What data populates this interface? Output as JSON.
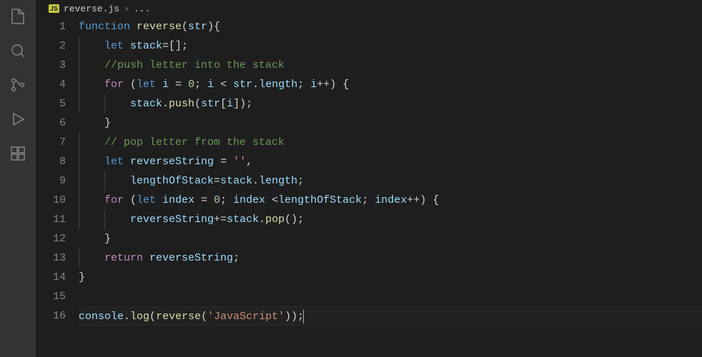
{
  "activity": {
    "icons": [
      "explorer",
      "search",
      "scm",
      "debug",
      "extensions"
    ]
  },
  "breadcrumbs": {
    "js_badge": "JS",
    "file": "reverse.js",
    "sep": "›",
    "tail": "..."
  },
  "gutter": {
    "start": 1,
    "end": 16
  },
  "code": {
    "lines": [
      [
        {
          "t": "function ",
          "c": "tok-kw"
        },
        {
          "t": "reverse",
          "c": "tok-fn"
        },
        {
          "t": "(",
          "c": "tok-op"
        },
        {
          "t": "str",
          "c": "tok-id"
        },
        {
          "t": "){",
          "c": "tok-op"
        }
      ],
      [
        {
          "t": "    ",
          "c": ""
        },
        {
          "t": "let ",
          "c": "tok-kw"
        },
        {
          "t": "stack",
          "c": "tok-id"
        },
        {
          "t": "=[];",
          "c": "tok-op"
        }
      ],
      [
        {
          "t": "    ",
          "c": ""
        },
        {
          "t": "//push letter into the stack",
          "c": "tok-cm"
        }
      ],
      [
        {
          "t": "    ",
          "c": ""
        },
        {
          "t": "for ",
          "c": "tok-ctrl"
        },
        {
          "t": "(",
          "c": "tok-op"
        },
        {
          "t": "let ",
          "c": "tok-kw"
        },
        {
          "t": "i",
          "c": "tok-id"
        },
        {
          "t": " = ",
          "c": "tok-op"
        },
        {
          "t": "0",
          "c": "tok-num"
        },
        {
          "t": "; ",
          "c": "tok-op"
        },
        {
          "t": "i",
          "c": "tok-id"
        },
        {
          "t": " < ",
          "c": "tok-op"
        },
        {
          "t": "str",
          "c": "tok-id"
        },
        {
          "t": ".",
          "c": "tok-op"
        },
        {
          "t": "length",
          "c": "tok-id"
        },
        {
          "t": "; ",
          "c": "tok-op"
        },
        {
          "t": "i",
          "c": "tok-id"
        },
        {
          "t": "++) {",
          "c": "tok-op"
        }
      ],
      [
        {
          "t": "        ",
          "c": ""
        },
        {
          "t": "stack",
          "c": "tok-id"
        },
        {
          "t": ".",
          "c": "tok-op"
        },
        {
          "t": "push",
          "c": "tok-fn"
        },
        {
          "t": "(",
          "c": "tok-op"
        },
        {
          "t": "str",
          "c": "tok-id"
        },
        {
          "t": "[",
          "c": "tok-op"
        },
        {
          "t": "i",
          "c": "tok-id"
        },
        {
          "t": "]);",
          "c": "tok-op"
        }
      ],
      [
        {
          "t": "    }",
          "c": "tok-op"
        }
      ],
      [
        {
          "t": "    ",
          "c": ""
        },
        {
          "t": "// pop letter from the stack",
          "c": "tok-cm"
        }
      ],
      [
        {
          "t": "    ",
          "c": ""
        },
        {
          "t": "let ",
          "c": "tok-kw"
        },
        {
          "t": "reverseString",
          "c": "tok-id"
        },
        {
          "t": " = ",
          "c": "tok-op"
        },
        {
          "t": "''",
          "c": "tok-str"
        },
        {
          "t": ",",
          "c": "tok-op"
        }
      ],
      [
        {
          "t": "        ",
          "c": ""
        },
        {
          "t": "lengthOfStack",
          "c": "tok-id"
        },
        {
          "t": "=",
          "c": "tok-op"
        },
        {
          "t": "stack",
          "c": "tok-id"
        },
        {
          "t": ".",
          "c": "tok-op"
        },
        {
          "t": "length",
          "c": "tok-id"
        },
        {
          "t": ";",
          "c": "tok-op"
        }
      ],
      [
        {
          "t": "    ",
          "c": ""
        },
        {
          "t": "for ",
          "c": "tok-ctrl"
        },
        {
          "t": "(",
          "c": "tok-op"
        },
        {
          "t": "let ",
          "c": "tok-kw"
        },
        {
          "t": "index",
          "c": "tok-id"
        },
        {
          "t": " = ",
          "c": "tok-op"
        },
        {
          "t": "0",
          "c": "tok-num"
        },
        {
          "t": "; ",
          "c": "tok-op"
        },
        {
          "t": "index",
          "c": "tok-id"
        },
        {
          "t": " <",
          "c": "tok-op"
        },
        {
          "t": "lengthOfStack",
          "c": "tok-id"
        },
        {
          "t": "; ",
          "c": "tok-op"
        },
        {
          "t": "index",
          "c": "tok-id"
        },
        {
          "t": "++) {",
          "c": "tok-op"
        }
      ],
      [
        {
          "t": "        ",
          "c": ""
        },
        {
          "t": "reverseString",
          "c": "tok-id"
        },
        {
          "t": "+=",
          "c": "tok-op"
        },
        {
          "t": "stack",
          "c": "tok-id"
        },
        {
          "t": ".",
          "c": "tok-op"
        },
        {
          "t": "pop",
          "c": "tok-fn"
        },
        {
          "t": "();",
          "c": "tok-op"
        }
      ],
      [
        {
          "t": "    }",
          "c": "tok-op"
        }
      ],
      [
        {
          "t": "    ",
          "c": ""
        },
        {
          "t": "return ",
          "c": "tok-ctrl"
        },
        {
          "t": "reverseString",
          "c": "tok-id"
        },
        {
          "t": ";",
          "c": "tok-op"
        }
      ],
      [
        {
          "t": "}",
          "c": "tok-op"
        }
      ],
      [],
      [
        {
          "t": "console",
          "c": "tok-id"
        },
        {
          "t": ".",
          "c": "tok-op"
        },
        {
          "t": "log",
          "c": "tok-fn"
        },
        {
          "t": "(",
          "c": "tok-op"
        },
        {
          "t": "reverse",
          "c": "tok-fn"
        },
        {
          "t": "(",
          "c": "tok-op"
        },
        {
          "t": "'JavaScript'",
          "c": "tok-str"
        },
        {
          "t": "));",
          "c": "tok-op"
        }
      ]
    ],
    "cursor_line": 16,
    "highlighted_line": 16
  }
}
